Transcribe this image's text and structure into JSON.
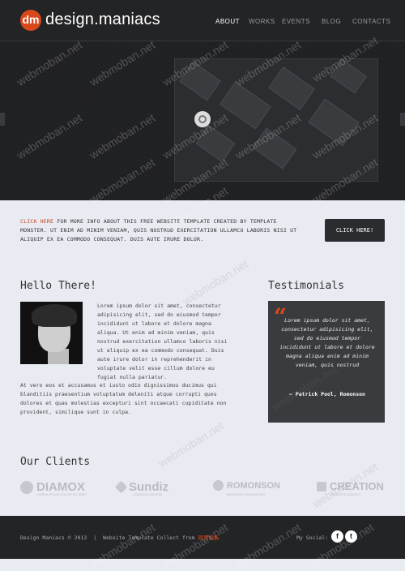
{
  "header": {
    "logo_mark": "dm",
    "logo_text": "design.maniacs",
    "nav": [
      "About",
      "Works",
      "Events",
      "Blog",
      "Contacts"
    ]
  },
  "promo": {
    "link": "CLICK HERE",
    "text": " FOR MORE INFO ABOUT THIS FREE WEBSITE TEMPLATE CREATED BY TEMPLATE MONSTER. UT ENIM AD MINIM VENIAM, QUIS NOSTRUD EXERCITATION ULLAMCO LABORIS NISI UT ALIQUIP EX EA COMMODO CONSEQUAT. DUIS AUTE IRURE DOLOR.",
    "button": "CLICK HERE!"
  },
  "hello": {
    "title": "Hello There!",
    "p1": "Lorem ipsum dolor sit amet, consectetur adipisicing elit, sed do eiusmod tempor incididunt ut labore et dolore magna aliqua. Ut enim ad minim veniam, quis nostrud exercitation ullamco laboris nisi ut aliquip ex ea commodo consequat. Duis aute irure dolor in reprehenderit in voluptate velit esse cillum dolore eu fugiat nulla pariatur.",
    "p2": "At vero eos et accusamus et iusto odio dignissimos ducimus qui blanditiis praesentium voluptatum deleniti atque corrupti quos dolores et quas molestias excepturi sint occaecati cupiditate non provident, similique sunt in culpa."
  },
  "testimonials": {
    "title": "Testimonials",
    "quote_mark": "“",
    "text": "Lorem ipsum dolor sit amet, consectetur adipisicing elit, sed do eiusmod tempor incididunt ut labore et dolore magna aliqua enim ad minim veniam, quis nostrud",
    "author": "— Patrick Pool, Romonson"
  },
  "clients": {
    "title": "Our Clients",
    "logos": [
      {
        "name": "DIAMOX",
        "tagline": "LOREM IPSUM DOLOR SIT AMET"
      },
      {
        "name": "Sundiz",
        "tagline": "CREATIVE DESIGN"
      },
      {
        "name": "ROMONSON",
        "tagline": "BUSINESS CONSULTING"
      },
      {
        "name": "CREATION",
        "tagline": "CREATIVE AGENCY"
      }
    ]
  },
  "footer": {
    "copyright": "Design Maniacs © 2013",
    "divider": "|",
    "collect": "Website Template Collect from ",
    "link": "网页模板",
    "social_label": "My Social:",
    "social": [
      "f",
      "t"
    ]
  },
  "watermark": "webmoban.net"
}
